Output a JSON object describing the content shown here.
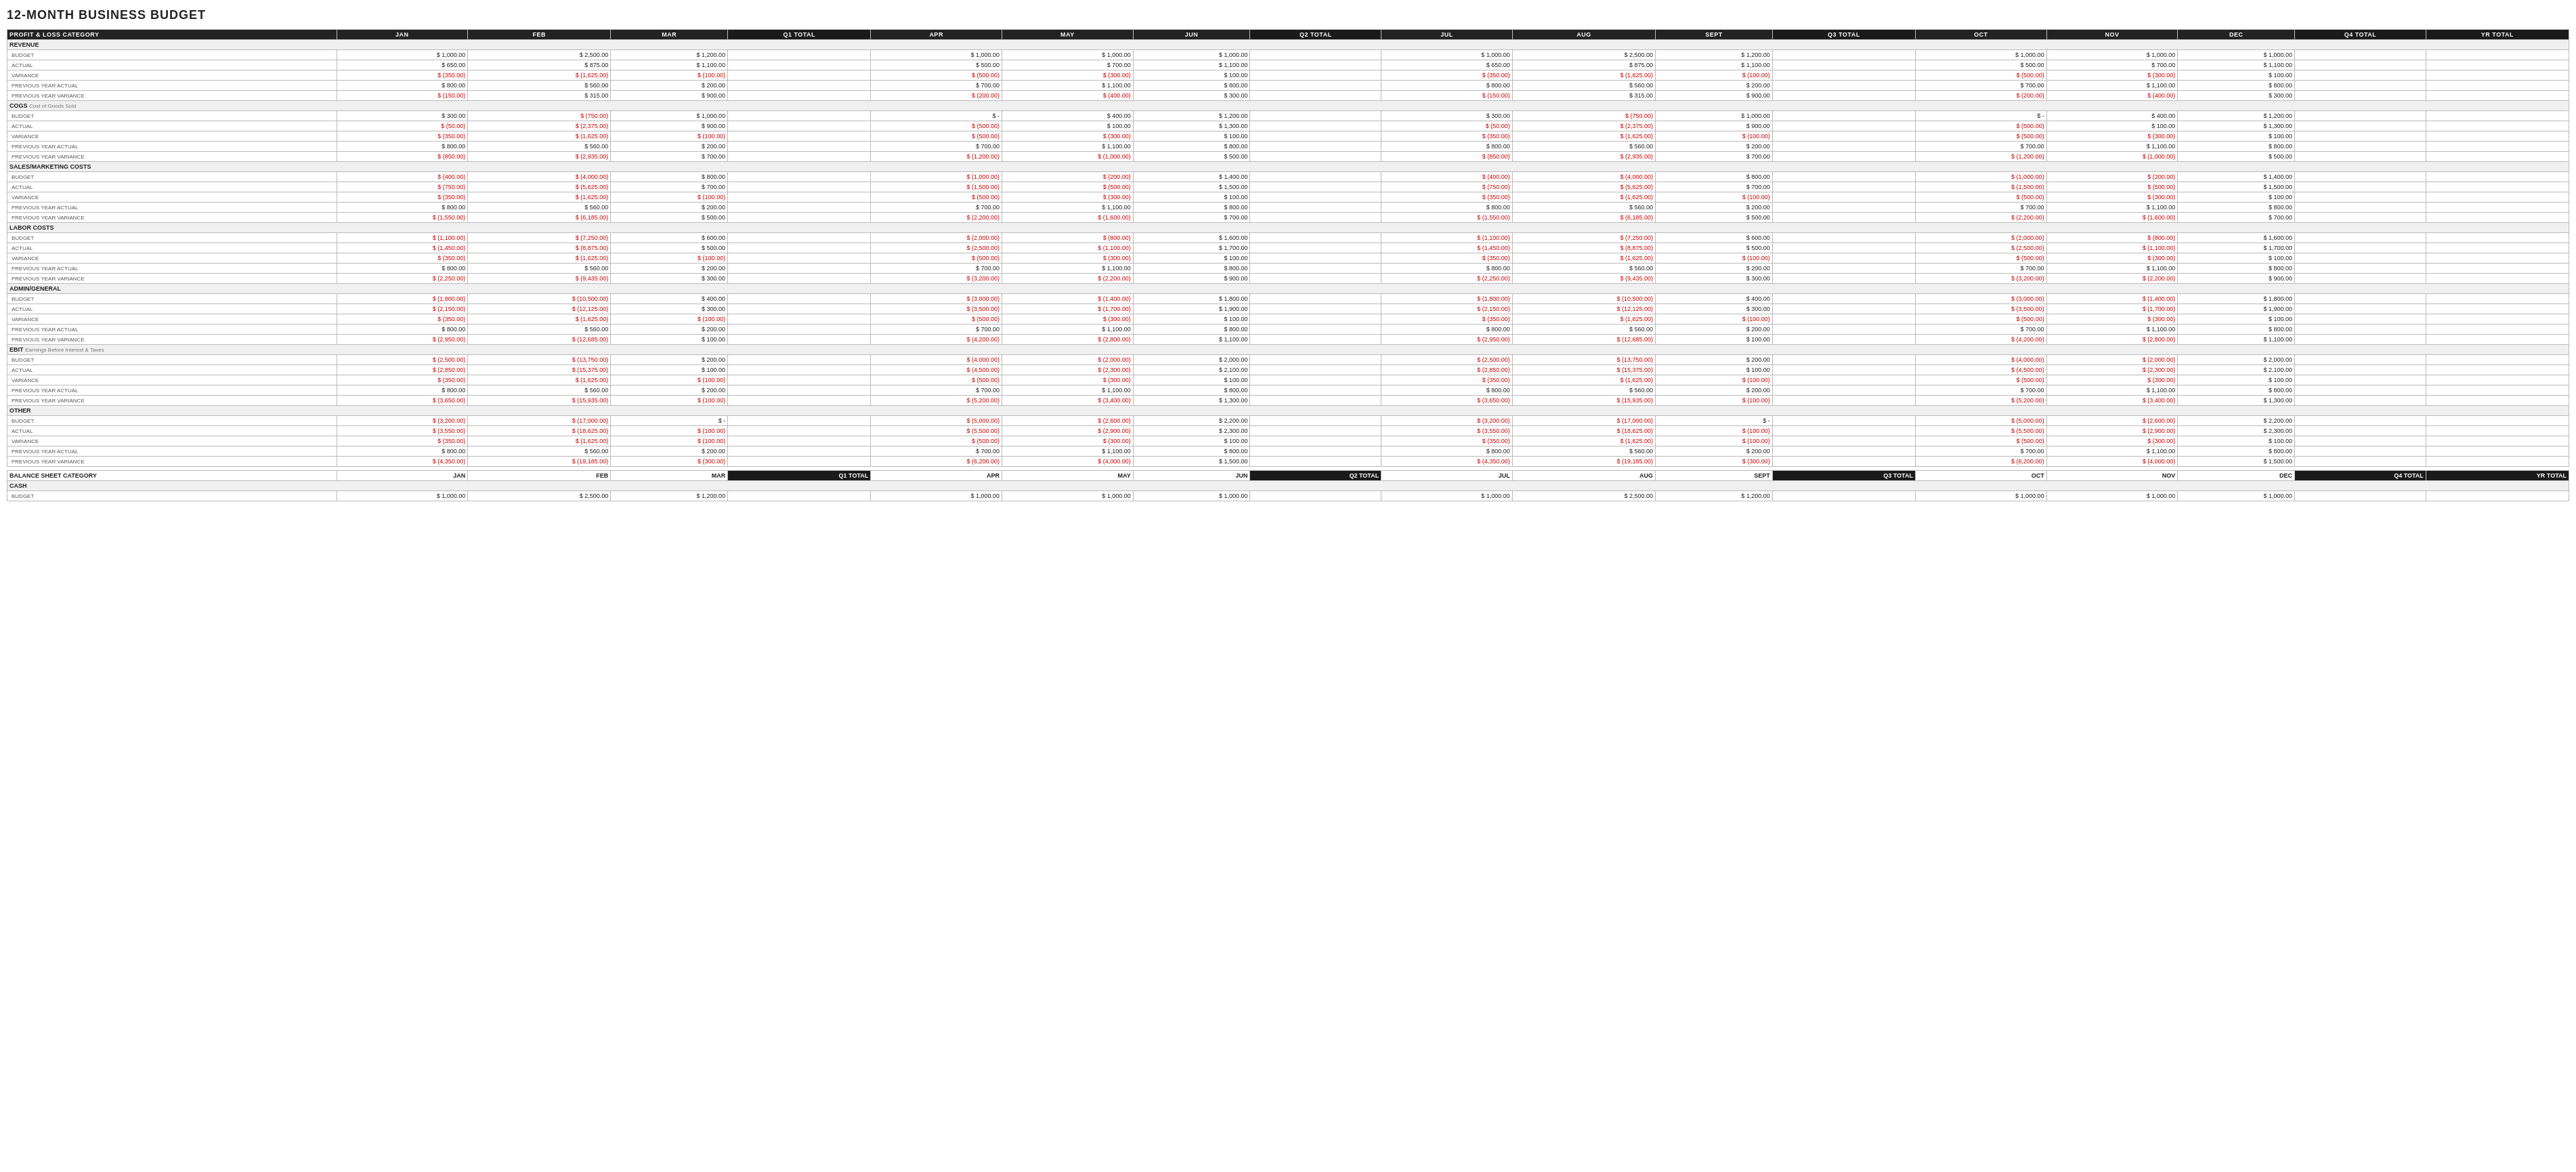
{
  "title": "12-MONTH BUSINESS BUDGET",
  "columns": {
    "headers": [
      "PROFIT & LOSS CATEGORY",
      "JAN",
      "FEB",
      "MAR",
      "Q1 TOTAL",
      "APR",
      "MAY",
      "JUN",
      "Q2 TOTAL",
      "JUL",
      "AUG",
      "SEPT",
      "Q3 TOTAL",
      "OCT",
      "NOV",
      "DEC",
      "Q4 TOTAL",
      "YR TOTAL"
    ]
  },
  "bottom_columns": {
    "headers": [
      "BALANCE SHEET CATEGORY",
      "JAN",
      "FEB",
      "MAR",
      "Q1 TOTAL",
      "APR",
      "MAY",
      "JUN",
      "Q2 TOTAL",
      "JUL",
      "AUG",
      "SEPT",
      "Q3 TOTAL",
      "OCT",
      "NOV",
      "DEC",
      "Q4 TOTAL",
      "YR TOTAL"
    ]
  },
  "sections": {
    "revenue": "REVENUE",
    "cogs": "COGS Cost of Goods Sold",
    "sales_marketing": "SALES/MARKETING COSTS",
    "labor": "LABOR COSTS",
    "admin": "ADMIN/GENERAL",
    "ebit": "EBIT Earnings Before Interest & Taxes",
    "other": "OTHER"
  },
  "row_labels": {
    "budget": "BUDGET",
    "actual": "ACTUAL",
    "variance": "VARIANCE",
    "prev_actual": "PREVIOUS YEAR ACTUAL",
    "prev_variance": "PREVIOUS YEAR VARIANCE"
  },
  "bottom_sections": {
    "cash": "CASH"
  }
}
